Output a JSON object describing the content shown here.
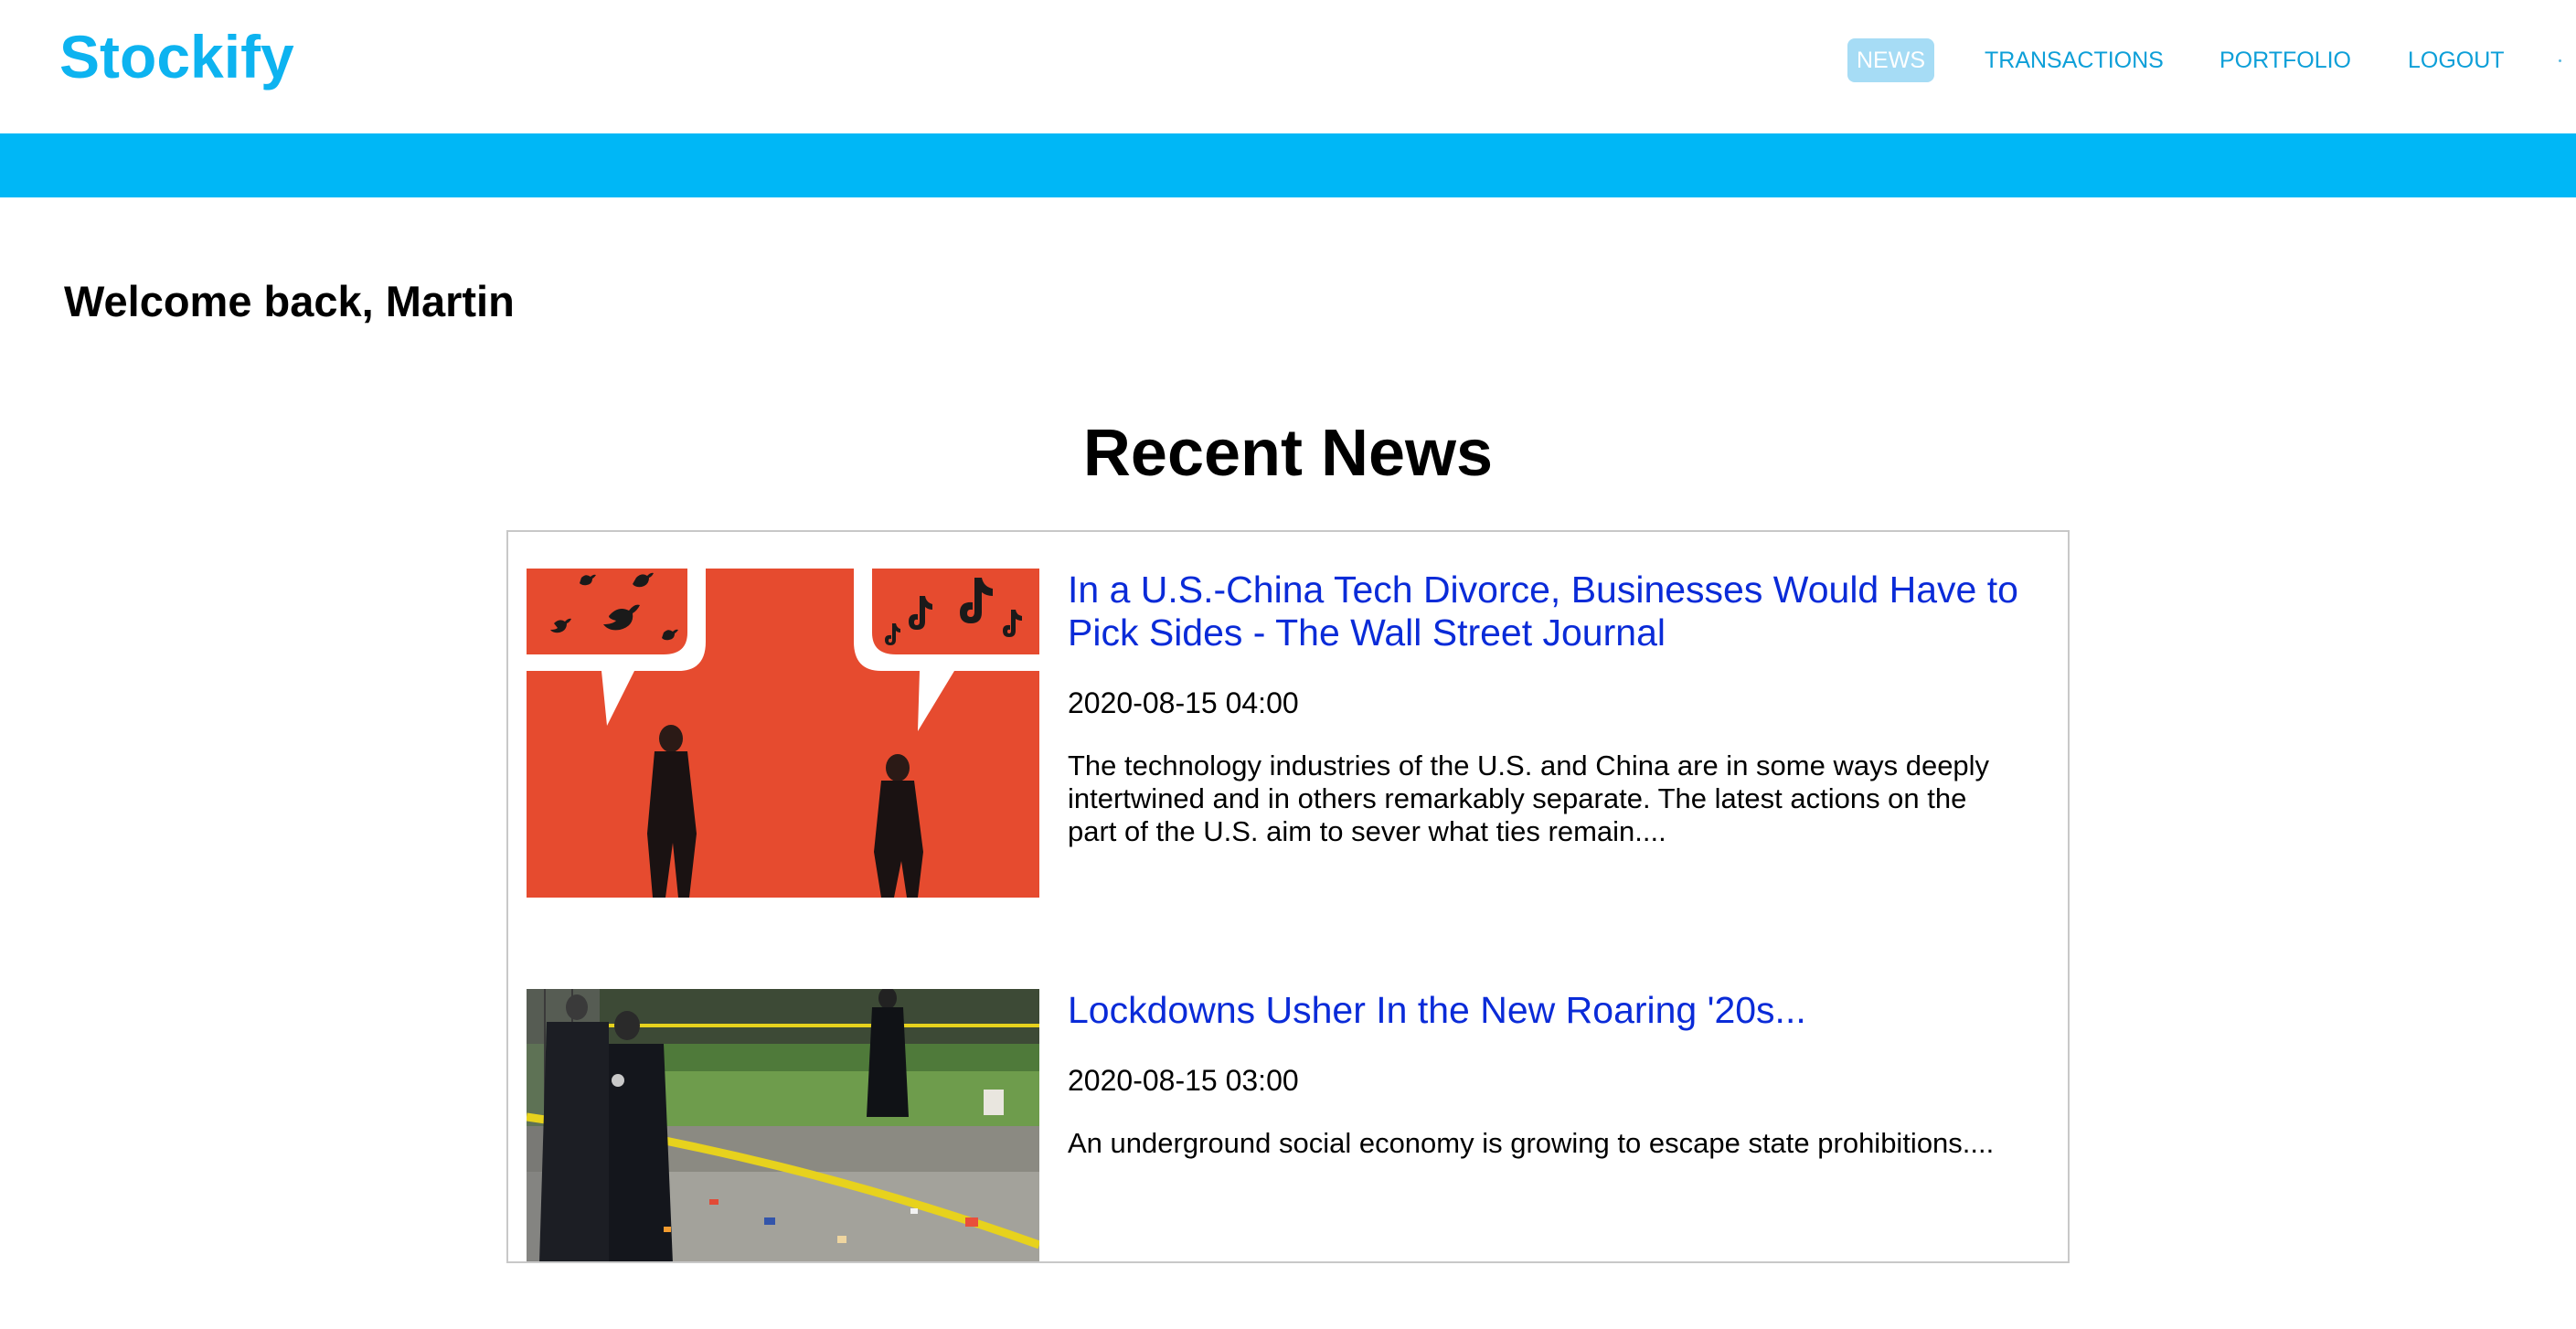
{
  "app": {
    "brand": "Stockify"
  },
  "nav": {
    "items": [
      {
        "label": "NEWS",
        "active": true
      },
      {
        "label": "TRANSACTIONS",
        "active": false
      },
      {
        "label": "PORTFOLIO",
        "active": false
      },
      {
        "label": "LOGOUT",
        "active": false
      }
    ]
  },
  "colors": {
    "brand": "#0db3f0",
    "band": "#00b7f6",
    "link": "#0a2bd8",
    "active_nav_bg": "#a6dcf5"
  },
  "welcome": "Welcome back, Martin",
  "section_title": "Recent News",
  "articles": [
    {
      "title": "In a U.S.-China Tech Divorce, Businesses Would Have to Pick Sides - The Wall Street Journal",
      "date": "2020-08-15 04:00",
      "description": "The technology industries of the U.S. and China are in some ways deeply intertwined and in others remarkably separate. The latest actions on the part of the U.S. aim to sever what ties remain...."
    },
    {
      "title": "Lockdowns Usher In the New Roaring '20s...",
      "date": "2020-08-15 03:00",
      "description": "An underground social economy is growing to escape state prohibitions...."
    }
  ]
}
